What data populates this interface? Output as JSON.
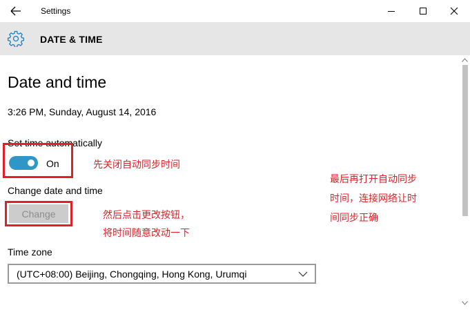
{
  "window": {
    "title": "Settings",
    "back_icon": "arrow-left-icon",
    "minimize_icon": "minimize-icon",
    "maximize_icon": "maximize-icon",
    "close_icon": "close-icon"
  },
  "header": {
    "icon": "gear-icon",
    "title": "DATE & TIME"
  },
  "main": {
    "page_title": "Date and time",
    "current_datetime": "3:26 PM, Sunday, August 14, 2016",
    "set_time_auto_label": "Set time automatically",
    "set_time_auto_state": "On",
    "change_date_label": "Change date and time",
    "change_button": "Change",
    "time_zone_label": "Time zone",
    "time_zone_value": "(UTC+08:00) Beijing, Chongqing, Hong Kong, Urumqi"
  },
  "annotations": {
    "note1": "先关闭自动同步时间",
    "note2_line1": "然后点击更改按钮，",
    "note2_line2": "将时间随意改动一下",
    "note3_line1": "最后再打开自动同步",
    "note3_line2": "时间，连接网络让时",
    "note3_line3": "间同步正确"
  },
  "colors": {
    "toggle_on": "#2e97c8",
    "annotation_red": "#e21f26",
    "header_bg": "#e6e6e6"
  }
}
